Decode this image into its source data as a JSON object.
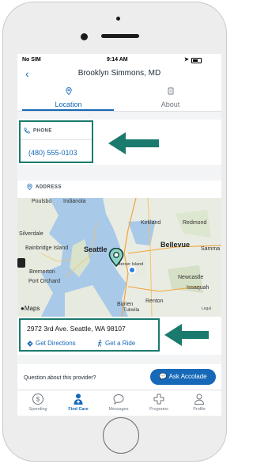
{
  "status_bar": {
    "carrier": "No SIM",
    "time": "9:14 AM"
  },
  "navbar": {
    "back_glyph": "‹",
    "title": "Brooklyn Simmons, MD"
  },
  "tabs": [
    {
      "label": "Location",
      "icon": "location-pin-icon",
      "active": true
    },
    {
      "label": "About",
      "icon": "document-icon",
      "active": false
    }
  ],
  "phone": {
    "heading": "PHONE",
    "number": "(480) 555-0103"
  },
  "address": {
    "heading": "ADDRESS",
    "street": "2972 3rd Ave. Seattle, WA 98107",
    "directions_label": "Get Directions",
    "ride_label": "Get a Ride"
  },
  "map": {
    "labels": {
      "poulsbo": "Poulsbo",
      "indianola": "Indianola",
      "kirkland": "Kirkland",
      "redmond": "Redmond",
      "silverdale": "Silverdale",
      "bainbridge": "Bainbridge Island",
      "seattle": "Seattle",
      "bellevue": "Bellevue",
      "sammamish": "Samma",
      "mercer": "Mercer Island",
      "bremerton": "Bremerton",
      "newcastle": "Newcastle",
      "port_orchard": "Port Orchard",
      "issaquah": "Issaquah",
      "burien": "Burien",
      "renton": "Renton",
      "tukwila": "Tukwila"
    },
    "brand": "Maps",
    "legal": "Legal"
  },
  "support": {
    "question": "Question about this provider?",
    "ask_label": "Ask Accolade"
  },
  "bottom_nav": [
    {
      "label": "Spending",
      "icon": "dollar-circle-icon"
    },
    {
      "label": "Find Care",
      "icon": "doctor-icon",
      "active": true
    },
    {
      "label": "Messages",
      "icon": "chat-bubble-icon"
    },
    {
      "label": "Programs",
      "icon": "medical-cross-icon"
    },
    {
      "label": "Profile",
      "icon": "person-icon"
    }
  ],
  "colors": {
    "accent": "#1668b8",
    "highlight_border": "#1a7a6d",
    "arrow": "#1a7a6d"
  }
}
